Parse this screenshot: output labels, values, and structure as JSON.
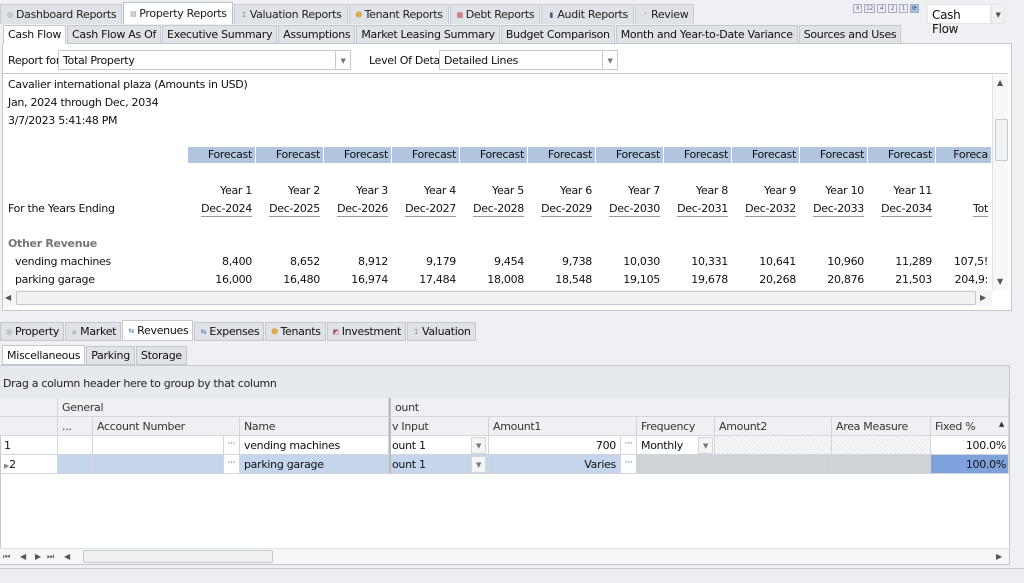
{
  "top_tabs": [
    {
      "label": "Dashboard Reports",
      "icon": "dashboard-icon",
      "glyph": "◎"
    },
    {
      "label": "Property Reports",
      "icon": "report-icon",
      "glyph": "▤",
      "active": true
    },
    {
      "label": "Valuation Reports",
      "icon": "valuation-icon",
      "glyph": "Ɪ"
    },
    {
      "label": "Tenant Reports",
      "icon": "tenant-icon",
      "glyph": "☻"
    },
    {
      "label": "Debt Reports",
      "icon": "debt-icon",
      "glyph": "▦"
    },
    {
      "label": "Audit Reports",
      "icon": "audit-icon",
      "glyph": "▮"
    },
    {
      "label": "Review",
      "icon": "review-icon",
      "glyph": "⁺"
    }
  ],
  "toolbar": {
    "buttons": [
      "⚱",
      "12",
      "4",
      "2",
      "1",
      "⟳"
    ],
    "report_select": "Cash Flow"
  },
  "report_tabs": [
    "Cash Flow",
    "Cash Flow As Of",
    "Executive Summary",
    "Assumptions",
    "Market Leasing Summary",
    "Budget Comparison",
    "Month and Year-to-Date Variance",
    "Sources and Uses"
  ],
  "filters": {
    "report_for_label": "Report for",
    "report_for_value": "Total Property",
    "level_label": "Level Of Detail",
    "level_value": "Detailed Lines"
  },
  "report": {
    "title": "Cavalier international plaza (Amounts in USD)",
    "period": "Jan, 2024 through Dec, 2034",
    "generated": "3/7/2023 5:41:48 PM",
    "row_label_years": "For the Years Ending",
    "section": "Other Revenue",
    "columns": [
      {
        "type": "Forecast",
        "year": "Year 1",
        "end": "Dec-2024"
      },
      {
        "type": "Forecast",
        "year": "Year 2",
        "end": "Dec-2025"
      },
      {
        "type": "Forecast",
        "year": "Year 3",
        "end": "Dec-2026"
      },
      {
        "type": "Forecast",
        "year": "Year 4",
        "end": "Dec-2027"
      },
      {
        "type": "Forecast",
        "year": "Year 5",
        "end": "Dec-2028"
      },
      {
        "type": "Forecast",
        "year": "Year 6",
        "end": "Dec-2029"
      },
      {
        "type": "Forecast",
        "year": "Year 7",
        "end": "Dec-2030"
      },
      {
        "type": "Forecast",
        "year": "Year 8",
        "end": "Dec-2031"
      },
      {
        "type": "Forecast",
        "year": "Year 9",
        "end": "Dec-2032"
      },
      {
        "type": "Forecast",
        "year": "Year 10",
        "end": "Dec-2033"
      },
      {
        "type": "Forecast",
        "year": "Year 11",
        "end": "Dec-2034"
      },
      {
        "type": "Foreca",
        "year": "",
        "end": "Tot"
      }
    ],
    "rows": [
      {
        "label": "vending machines",
        "values": [
          "8,400",
          "8,652",
          "8,912",
          "9,179",
          "9,454",
          "9,738",
          "10,030",
          "10,331",
          "10,641",
          "10,960",
          "11,289",
          "107,5!"
        ]
      },
      {
        "label": "parking garage",
        "values": [
          "16,000",
          "16,480",
          "16,974",
          "17,484",
          "18,008",
          "18,548",
          "19,105",
          "19,678",
          "20,268",
          "20,876",
          "21,503",
          "204,9:"
        ]
      }
    ]
  },
  "bottom_tabs": [
    {
      "label": "Property",
      "glyph": "◎"
    },
    {
      "label": "Market",
      "glyph": "⌂"
    },
    {
      "label": "Revenues",
      "glyph": "⇆",
      "active": true
    },
    {
      "label": "Expenses",
      "glyph": "⇆"
    },
    {
      "label": "Tenants",
      "glyph": "☻"
    },
    {
      "label": "Investment",
      "glyph": "◩"
    },
    {
      "label": "Valuation",
      "glyph": "Ɪ"
    }
  ],
  "sub_tabs": [
    "Miscellaneous",
    "Parking",
    "Storage"
  ],
  "grid": {
    "group_hint": "Drag a column header here to group by that column",
    "bands": [
      "General",
      "ount"
    ],
    "headers": [
      "...",
      "Account Number",
      "Name",
      "v Input",
      "Amount1",
      "Frequency",
      "Amount2",
      "Area Measure",
      "Fixed %"
    ],
    "rows": [
      {
        "num": "1",
        "account": "",
        "name": "vending machines",
        "input": "ount 1",
        "amount1": "700",
        "frequency": "Monthly",
        "fixed": "100.0%"
      },
      {
        "num": "2",
        "account": "",
        "name": "parking garage",
        "input": "ount 1",
        "amount1": "Varies",
        "frequency": "",
        "fixed": "100.0%"
      }
    ]
  },
  "colors": {
    "forecast_header": "#b1c5de",
    "selected_row": "#c5d5ec",
    "selected_cell": "#7ea3dc"
  }
}
